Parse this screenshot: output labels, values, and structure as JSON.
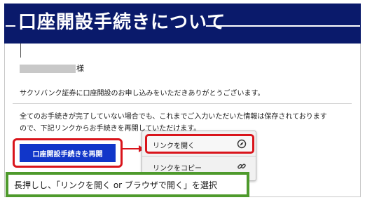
{
  "header": {
    "title": "口座開設手続きについて"
  },
  "greeting": {
    "suffix": "様"
  },
  "message": {
    "line1": "サクソバンク証券に口座開設のお申し込みをいただきありがとうございます。",
    "line2": "全てのお手続きが完了していない場合でも、これまでご入力いただいた情報は保存されております",
    "line3": "ので、下記リンクからお手続きを再開していただけます。"
  },
  "resume_button": {
    "label": "口座開設手続きを再開"
  },
  "context_menu": {
    "items": [
      {
        "label": "リンクを開く",
        "icon": "compass-icon"
      },
      {
        "label": "リンクをコピー",
        "icon": "link-icon"
      }
    ]
  },
  "caption": {
    "text": "長押しし、「リンクを開く or ブラウザで開く」を選択"
  },
  "colors": {
    "header_bg": "#0a1a6b",
    "button_bg": "#1136c9",
    "highlight": "#d9141b",
    "caption_border": "#4e9a2c"
  }
}
